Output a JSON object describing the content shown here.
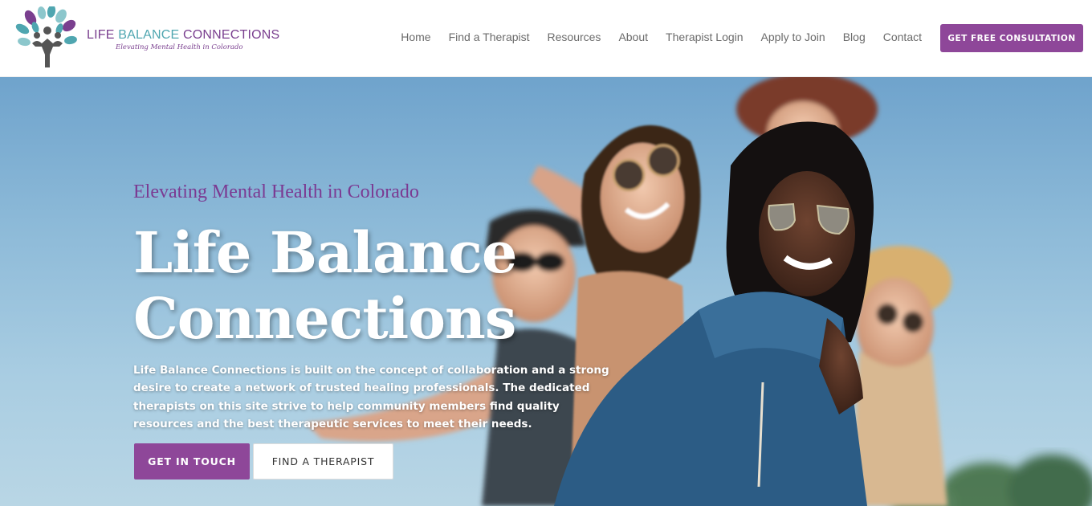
{
  "header": {
    "logo": {
      "title_part1": "LIFE ",
      "title_part2": "BALANCE ",
      "title_part3": "CONNECTIONS",
      "tagline": "Elevating Mental Health in Colorado",
      "icon": "tree-people-logo"
    },
    "nav": [
      {
        "label": "Home"
      },
      {
        "label": "Find a Therapist"
      },
      {
        "label": "Resources"
      },
      {
        "label": "About"
      },
      {
        "label": "Therapist Login"
      },
      {
        "label": "Apply to Join"
      },
      {
        "label": "Blog"
      },
      {
        "label": "Contact"
      }
    ],
    "cta_label": "GET FREE CONSULTATION"
  },
  "hero": {
    "subtitle": "Elevating Mental Health in Colorado",
    "title": "Life Balance Connections",
    "description": "Life Balance Connections is built on the concept of collaboration and a strong desire to create a network of trusted healing professionals. The dedicated therapists on this site strive to help community members find quality resources and the best therapeutic services to meet their needs.",
    "primary_button": "GET IN TOUCH",
    "secondary_button": "FIND A THERAPIST",
    "image": "group-of-friends-photo"
  },
  "colors": {
    "brand_purple": "#8e4799",
    "brand_teal": "#4fa6b0",
    "nav_text": "#6b6b6b",
    "sky": "#8dbad8"
  }
}
